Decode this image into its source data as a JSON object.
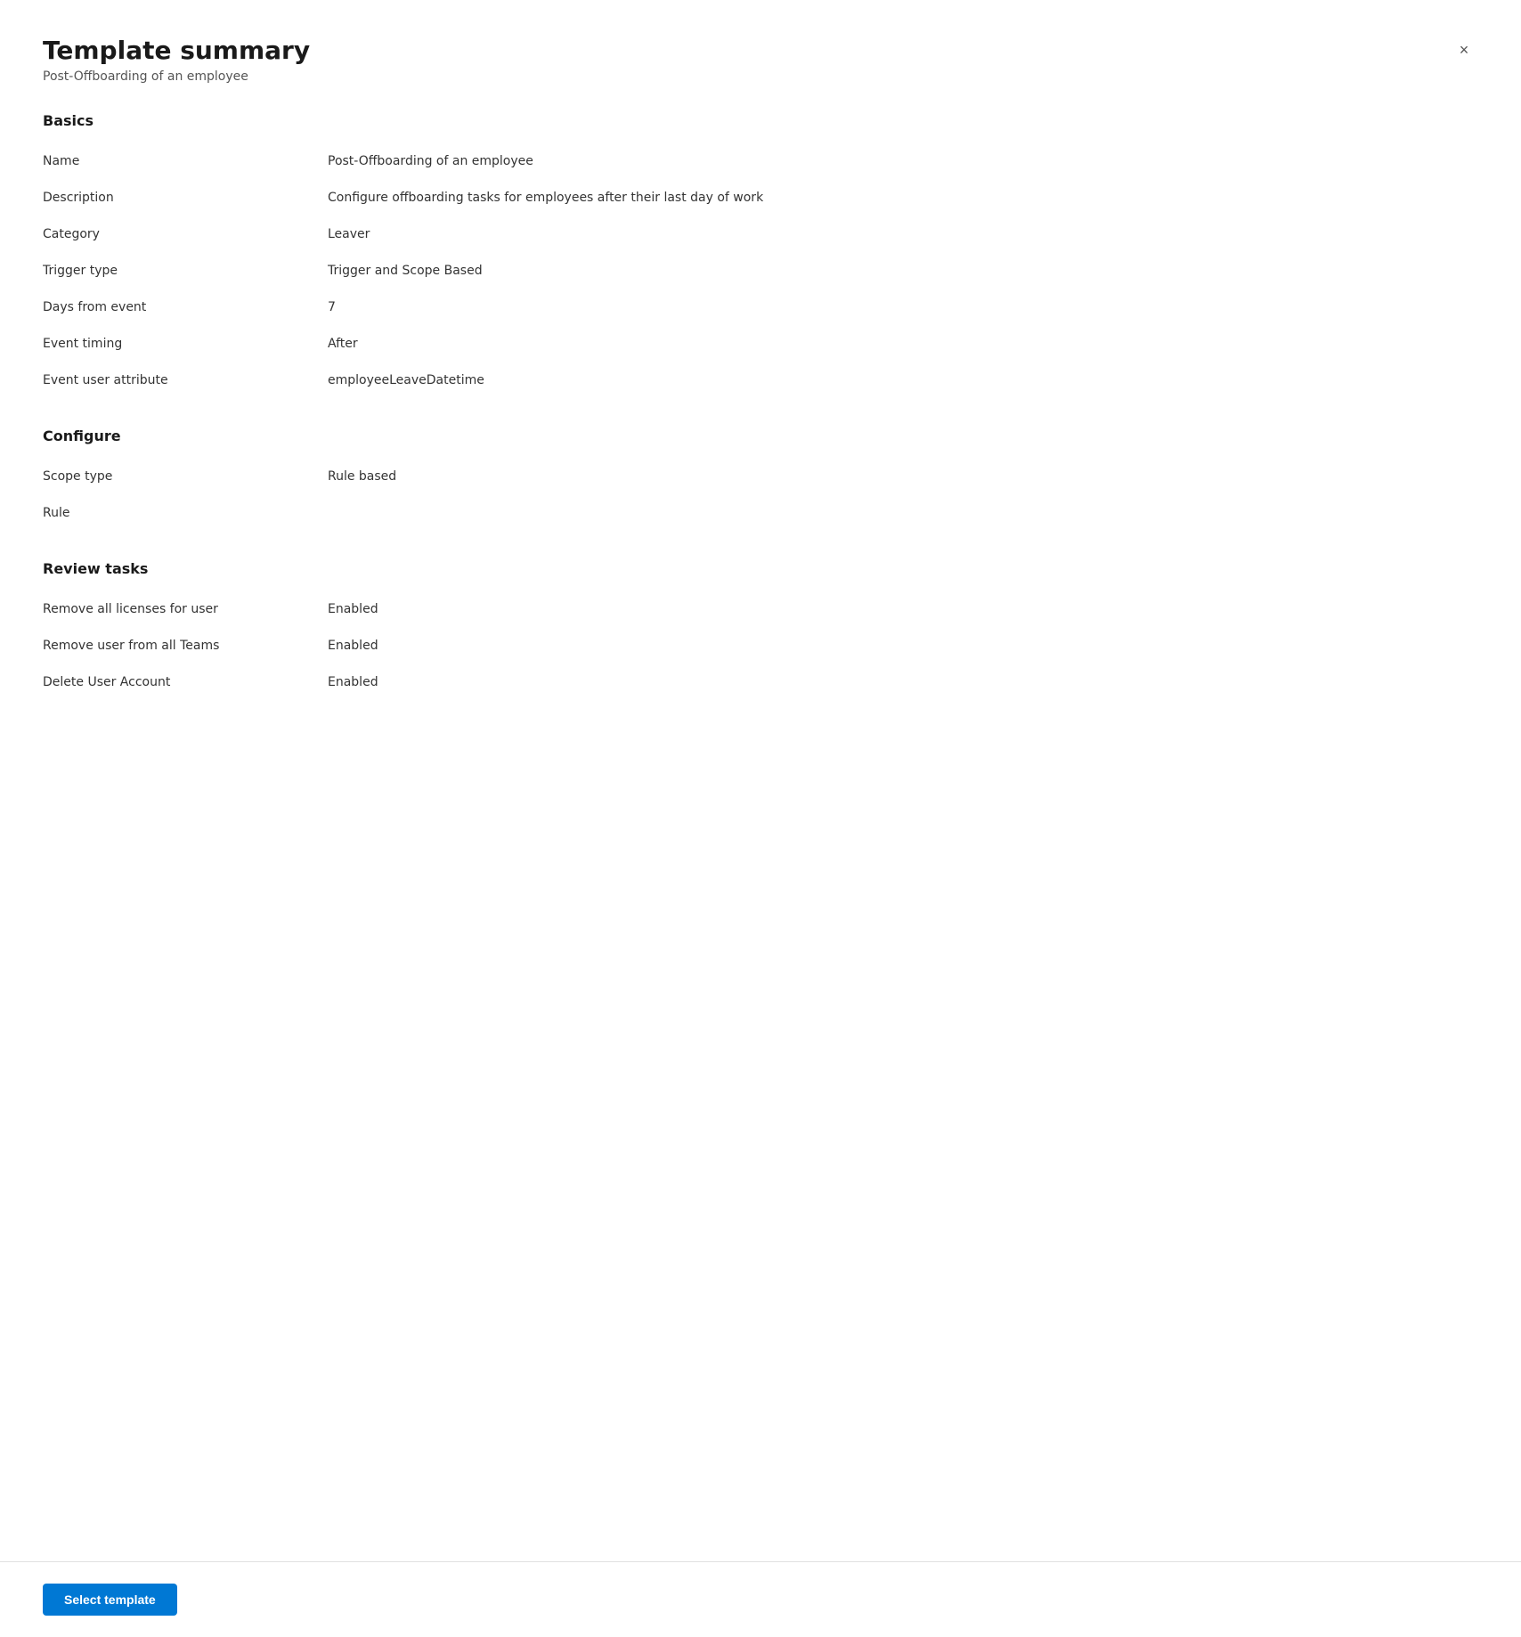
{
  "panel": {
    "title": "Template summary",
    "subtitle": "Post-Offboarding of an employee",
    "close_label": "×"
  },
  "sections": {
    "basics": {
      "title": "Basics",
      "fields": [
        {
          "label": "Name",
          "value": "Post-Offboarding of an employee"
        },
        {
          "label": "Description",
          "value": "Configure offboarding tasks for employees after their last day of work"
        },
        {
          "label": "Category",
          "value": "Leaver"
        },
        {
          "label": "Trigger type",
          "value": "Trigger and Scope Based"
        },
        {
          "label": "Days from event",
          "value": "7"
        },
        {
          "label": "Event timing",
          "value": "After"
        },
        {
          "label": "Event user attribute",
          "value": "employeeLeaveDatetime"
        }
      ]
    },
    "configure": {
      "title": "Configure",
      "fields": [
        {
          "label": "Scope type",
          "value": "Rule based"
        },
        {
          "label": "Rule",
          "value": ""
        }
      ]
    },
    "review_tasks": {
      "title": "Review tasks",
      "fields": [
        {
          "label": "Remove all licenses for user",
          "value": "Enabled"
        },
        {
          "label": "Remove user from all Teams",
          "value": "Enabled"
        },
        {
          "label": "Delete User Account",
          "value": "Enabled"
        }
      ]
    }
  },
  "footer": {
    "select_template_label": "Select template"
  }
}
